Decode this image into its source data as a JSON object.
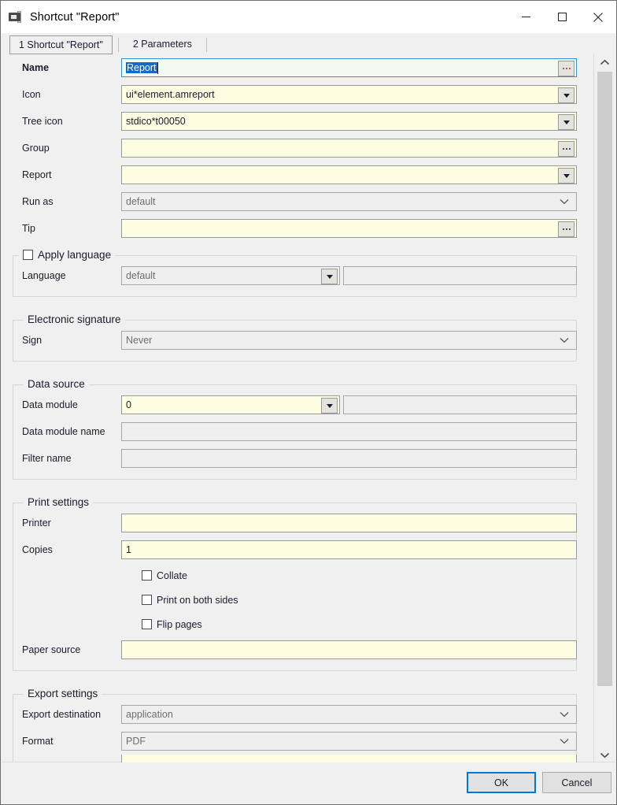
{
  "window": {
    "title": "Shortcut \"Report\"",
    "icon": "app-icon",
    "controls": {
      "minimize": "minimize-icon",
      "maximize": "maximize-icon",
      "close": "close-icon"
    }
  },
  "tabs": [
    {
      "label": "1 Shortcut \"Report\"",
      "selected": true
    },
    {
      "label": "2 Parameters",
      "selected": false
    }
  ],
  "form": {
    "name": {
      "label": "Name",
      "value": "Report",
      "button": "ellipsis-red"
    },
    "icon": {
      "label": "Icon",
      "value": "ui*element.amreport",
      "button": "dropdown"
    },
    "tree_icon": {
      "label": "Tree icon",
      "value": "stdico*t00050",
      "button": "dropdown"
    },
    "group": {
      "label": "Group",
      "value": "",
      "button": "ellipsis"
    },
    "report": {
      "label": "Report",
      "value": "",
      "button": "dropdown"
    },
    "run_as": {
      "label": "Run as",
      "value": "default",
      "button": "chevron"
    },
    "tip": {
      "label": "Tip",
      "value": "",
      "button": "ellipsis"
    }
  },
  "apply_language": {
    "title": "Apply language",
    "checked": false,
    "language": {
      "label": "Language",
      "value": "default",
      "extra_value": ""
    }
  },
  "electronic_signature": {
    "title": "Electronic signature",
    "sign": {
      "label": "Sign",
      "value": "Never"
    }
  },
  "data_source": {
    "title": "Data source",
    "data_module": {
      "label": "Data module",
      "value": "0",
      "extra_value": ""
    },
    "data_module_name": {
      "label": "Data module name",
      "value": ""
    },
    "filter_name": {
      "label": "Filter name",
      "value": ""
    }
  },
  "print_settings": {
    "title": "Print settings",
    "printer": {
      "label": "Printer",
      "value": ""
    },
    "copies": {
      "label": "Copies",
      "value": "1"
    },
    "collate": {
      "label": "Collate",
      "checked": false
    },
    "both_sides": {
      "label": "Print on both sides",
      "checked": false
    },
    "flip_pages": {
      "label": "Flip pages",
      "checked": false
    },
    "paper_source": {
      "label": "Paper source",
      "value": ""
    }
  },
  "export_settings": {
    "title": "Export settings",
    "destination": {
      "label": "Export destination",
      "value": "application"
    },
    "format": {
      "label": "Format",
      "value": "PDF"
    }
  },
  "footer": {
    "ok": "OK",
    "cancel": "Cancel"
  },
  "scrollbar": {
    "up": "scroll-up-icon",
    "down": "scroll-down-icon"
  },
  "colors": {
    "field_yellow": "#fdfde2",
    "focus_blue": "#0078d7",
    "selection_blue": "#1569c7",
    "window_bg": "#f0f0f0"
  }
}
